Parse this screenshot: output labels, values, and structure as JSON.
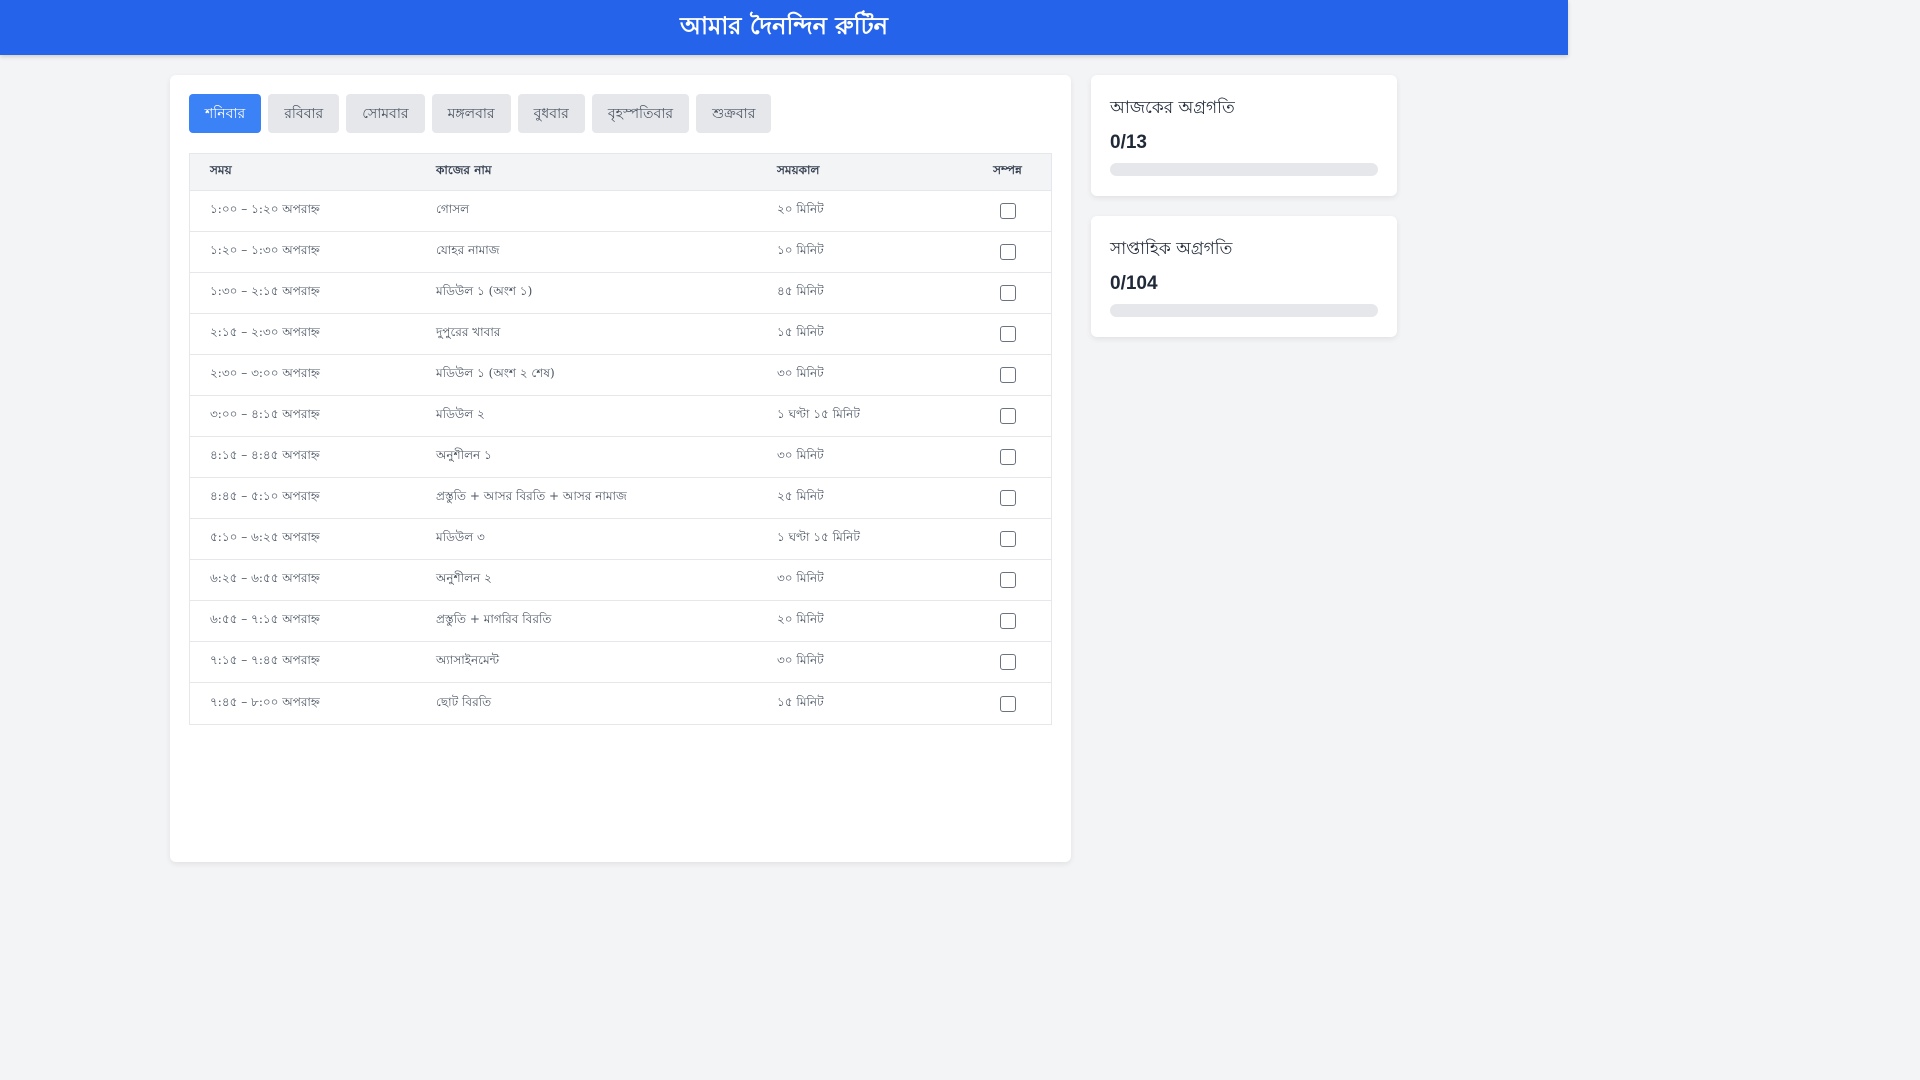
{
  "header": {
    "title": "আমার দৈনন্দিন রুটিন"
  },
  "colors": {
    "header_bg": "#2563eb",
    "accent": "#3b82f6",
    "tab_bg": "#e5e7eb"
  },
  "tabs": [
    {
      "label": "শনিবার",
      "active": true
    },
    {
      "label": "রবিবার",
      "active": false
    },
    {
      "label": "সোমবার",
      "active": false
    },
    {
      "label": "মঙ্গলবার",
      "active": false
    },
    {
      "label": "বুধবার",
      "active": false
    },
    {
      "label": "বৃহস্পতিবার",
      "active": false
    },
    {
      "label": "শুক্রবার",
      "active": false
    }
  ],
  "table": {
    "headers": {
      "time": "সময়",
      "task": "কাজের নাম",
      "duration": "সময়কাল",
      "done": "সম্পন্ন"
    },
    "rows": [
      {
        "time": "১:০০ – ১:২০ অপরাহ্ন",
        "task": "গোসল",
        "duration": "২০ মিনিট",
        "done": false
      },
      {
        "time": "১:২০ – ১:৩০ অপরাহ্ন",
        "task": "যোহর নামাজ",
        "duration": "১০ মিনিট",
        "done": false
      },
      {
        "time": "১:৩০ – ২:১৫ অপরাহ্ন",
        "task": "মডিউল ১ (অংশ ১)",
        "duration": "৪৫ মিনিট",
        "done": false
      },
      {
        "time": "২:১৫ – ২:৩০ অপরাহ্ন",
        "task": "দুপুরের খাবার",
        "duration": "১৫ মিনিট",
        "done": false
      },
      {
        "time": "২:৩০ – ৩:০০ অপরাহ্ন",
        "task": "মডিউল ১ (অংশ ২ শেষ)",
        "duration": "৩০ মিনিট",
        "done": false
      },
      {
        "time": "৩:০০ – ৪:১৫ অপরাহ্ন",
        "task": "মডিউল ২",
        "duration": "১ ঘণ্টা ১৫ মিনিট",
        "done": false
      },
      {
        "time": "৪:১৫ – ৪:৪৫ অপরাহ্ন",
        "task": "অনুশীলন ১",
        "duration": "৩০ মিনিট",
        "done": false
      },
      {
        "time": "৪:৪৫ – ৫:১০ অপরাহ্ন",
        "task": "প্রস্তুতি + আসর বিরতি + আসর নামাজ",
        "duration": "২৫ মিনিট",
        "done": false
      },
      {
        "time": "৫:১০ – ৬:২৫ অপরাহ্ন",
        "task": "মডিউল ৩",
        "duration": "১ ঘণ্টা ১৫ মিনিট",
        "done": false
      },
      {
        "time": "৬:২৫ – ৬:৫৫ অপরাহ্ন",
        "task": "অনুশীলন ২",
        "duration": "৩০ মিনিট",
        "done": false
      },
      {
        "time": "৬:৫৫ – ৭:১৫ অপরাহ্ন",
        "task": "প্রস্তুতি + মাগরিব বিরতি",
        "duration": "২০ মিনিট",
        "done": false
      },
      {
        "time": "৭:১৫ – ৭:৪৫ অপরাহ্ন",
        "task": "অ্যাসাইনমেন্ট",
        "duration": "৩০ মিনিট",
        "done": false
      },
      {
        "time": "৭:৪৫ – ৮:০০ অপরাহ্ন",
        "task": "ছোট বিরতি",
        "duration": "১৫ মিনিট",
        "done": false
      }
    ]
  },
  "today_progress": {
    "title": "আজকের অগ্রগতি",
    "count": "0/13",
    "fraction": 0
  },
  "weekly_progress": {
    "title": "সাপ্তাহিক অগ্রগতি",
    "count": "0/104",
    "fraction": 0
  }
}
